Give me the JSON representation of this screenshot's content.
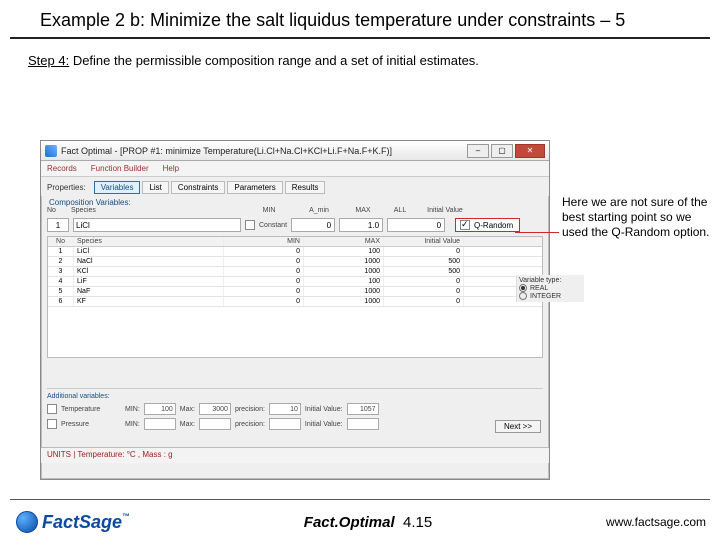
{
  "slide": {
    "title": "Example 2 b: Minimize the salt liquidus temperature under constraints – 5",
    "step_label": "Step 4:",
    "step_text": " Define the permissible composition range and a set of initial estimates."
  },
  "app": {
    "window_title": "Fact Optimal - [PROP #1: minimize Temperature(Li.Cl+Na.Cl+KCl+Li.F+Na.F+K.F)]",
    "menu": {
      "records": "Records",
      "builder": "Function Builder",
      "help": "Help"
    },
    "tabs_label": "Properties:",
    "tabs": [
      "Variables",
      "List",
      "Constraints",
      "Parameters",
      "Results"
    ],
    "active_tab_index": 0,
    "section_composition": "Composition Variables:",
    "colhdr": {
      "no": "No",
      "species": "Species",
      "min": "MIN",
      "amin": "A_min",
      "max": "MAX",
      "all": "ALL",
      "initval": "Initial Value"
    },
    "summary": {
      "no": "1",
      "species": "LiCl",
      "constant_label": "Constant",
      "min": "0",
      "max": "1.0",
      "initval": "0"
    },
    "qrandom_label": "Q-Random",
    "table": {
      "headers": {
        "no": "No",
        "species": "Species",
        "min": "MIN",
        "max": "MAX",
        "initval": "Initial Value"
      },
      "rows": [
        {
          "no": "1",
          "sp": "LiCl",
          "min": "0",
          "max": "100",
          "iv": "0"
        },
        {
          "no": "2",
          "sp": "NaCl",
          "min": "0",
          "max": "1000",
          "iv": "500"
        },
        {
          "no": "3",
          "sp": "KCl",
          "min": "0",
          "max": "1000",
          "iv": "500"
        },
        {
          "no": "4",
          "sp": "LiF",
          "min": "0",
          "max": "100",
          "iv": "0"
        },
        {
          "no": "5",
          "sp": "NaF",
          "min": "0",
          "max": "1000",
          "iv": "0"
        },
        {
          "no": "6",
          "sp": "KF",
          "min": "0",
          "max": "1000",
          "iv": "0"
        }
      ]
    },
    "vartype": {
      "label": "Variable type:",
      "real": "REAL",
      "integer": "INTEGER"
    },
    "addl": {
      "label": "Additional variables:",
      "temperature": "Temperature",
      "pressure": "Pressure",
      "min_l": "MIN:",
      "max_l": "Max:",
      "prec_l": "precision:",
      "iv_l": "Initial Value:",
      "t_min": "100",
      "t_max": "3000",
      "t_prec": "10",
      "t_iv": "1057",
      "p_min": "",
      "p_max": "",
      "p_prec": "",
      "p_iv": ""
    },
    "next_btn": "Next >>",
    "status": "UNITS | Temperature: °C , Mass : g"
  },
  "callout": "Here we are not sure of the best starting point so we used the Q-Random option.",
  "footer": {
    "brand_f": "Fact",
    "brand_s": "Sage",
    "tm": "™",
    "product": "Fact.Optimal",
    "slide_no": "4.15",
    "url": "www.factsage.com"
  }
}
